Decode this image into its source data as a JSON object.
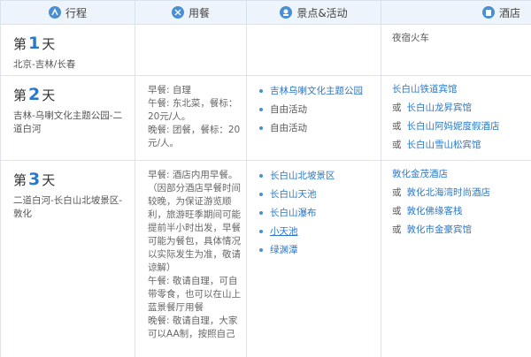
{
  "header": {
    "col1": "行程",
    "col2": "用餐",
    "col3": "景点&活动",
    "col4": "酒店"
  },
  "days": [
    {
      "prefix": "第",
      "num": "1",
      "suffix": "天",
      "route": "北京-吉林/长春",
      "meals": [],
      "activities": [],
      "hotel": {
        "text": "夜宿火车",
        "items": []
      }
    },
    {
      "prefix": "第",
      "num": "2",
      "suffix": "天",
      "route": "吉林-乌喇文化主题公园-二道白河",
      "meals": [
        "早餐: 自理",
        "午餐: 东北菜，餐标：20元/人。",
        "晚餐: 团餐，餐标：20元/人。"
      ],
      "activities": [
        {
          "label": "吉林乌喇文化主题公园",
          "link": true
        },
        {
          "label": "自由活动",
          "link": false
        },
        {
          "label": "自由活动",
          "link": false
        }
      ],
      "hotel": {
        "text": "",
        "items": [
          {
            "or": "",
            "name": "长白山铁道宾馆"
          },
          {
            "or": "或",
            "name": "长白山龙昇宾馆"
          },
          {
            "or": "或",
            "name": "长白山阿妈妮度假酒店"
          },
          {
            "or": "或",
            "name": "长白山雪山松宾馆"
          }
        ]
      }
    },
    {
      "prefix": "第",
      "num": "3",
      "suffix": "天",
      "route": "二道白河-长白山北坡景区-敦化",
      "meals": [
        "早餐: 酒店内用早餐。（因部分酒店早餐时间较晚，为保证游览顺利，旅游旺季期间可能提前半小时出发，早餐可能为餐包，具体情况以实际发生为准，敬请谅解）",
        "午餐: 敬请自理，可自带零食，也可以在山上蓝景餐厅用餐",
        "晚餐: 敬请自理，大家可以AA制，按照自己"
      ],
      "activities": [
        {
          "label": "长白山北坡景区",
          "link": true
        },
        {
          "label": "长白山天池",
          "link": true
        },
        {
          "label": "长白山瀑布",
          "link": true
        },
        {
          "label": "小天池",
          "link": true,
          "underline": true
        },
        {
          "label": "绿渊潭",
          "link": true
        }
      ],
      "hotel": {
        "text": "",
        "items": [
          {
            "or": "",
            "name": "敦化金茂酒店"
          },
          {
            "or": "或",
            "name": "敦化北海湾时尚酒店"
          },
          {
            "or": "或",
            "name": "敦化佛缘客栈"
          },
          {
            "or": "或",
            "name": "敦化市金豪宾馆"
          }
        ]
      }
    }
  ],
  "colors": {
    "accent": "#2a78c8",
    "header_bg": "#eef4fb",
    "border": "#dde3ea"
  }
}
